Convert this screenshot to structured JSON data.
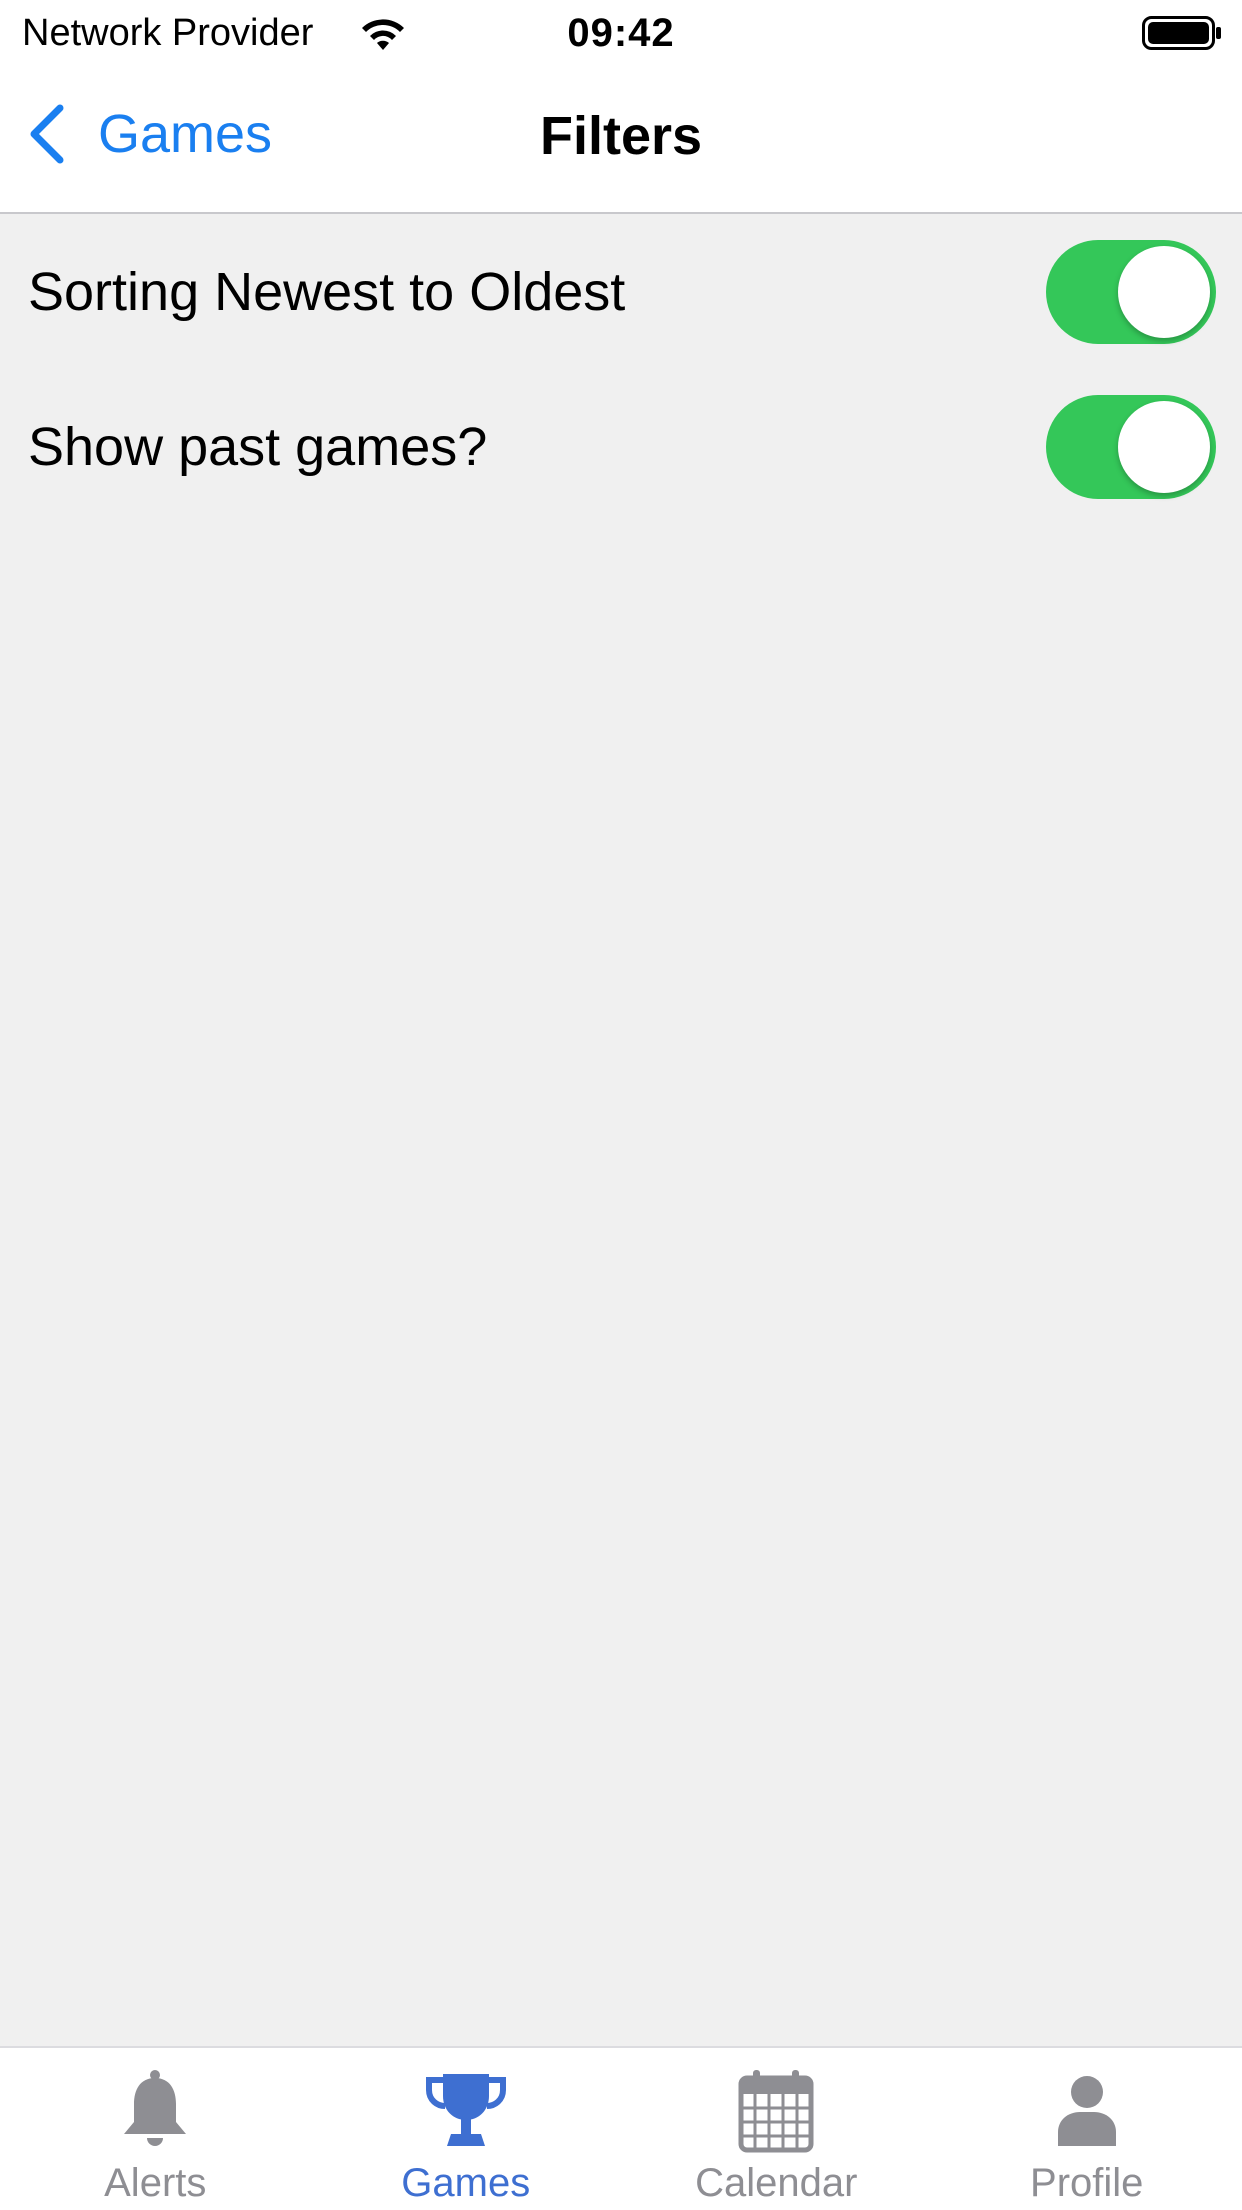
{
  "status_bar": {
    "carrier": "Network Provider",
    "time": "09:42",
    "icons": [
      "wifi-icon",
      "battery-icon"
    ]
  },
  "nav_bar": {
    "back_label": "Games",
    "title": "Filters",
    "back_icon": "chevron-left-icon",
    "accent_color": "#1a7ff0"
  },
  "settings": [
    {
      "label": "Sorting Newest to Oldest",
      "enabled": true
    },
    {
      "label": "Show past games?",
      "enabled": true
    }
  ],
  "toggle_on_color": "#34c759",
  "tab_bar": {
    "active_color": "#3e6fd1",
    "inactive_color": "#8e8e93",
    "active_index": 1,
    "items": [
      {
        "label": "Alerts",
        "icon": "bell-icon"
      },
      {
        "label": "Games",
        "icon": "trophy-icon"
      },
      {
        "label": "Calendar",
        "icon": "calendar-icon"
      },
      {
        "label": "Profile",
        "icon": "person-icon"
      }
    ]
  }
}
